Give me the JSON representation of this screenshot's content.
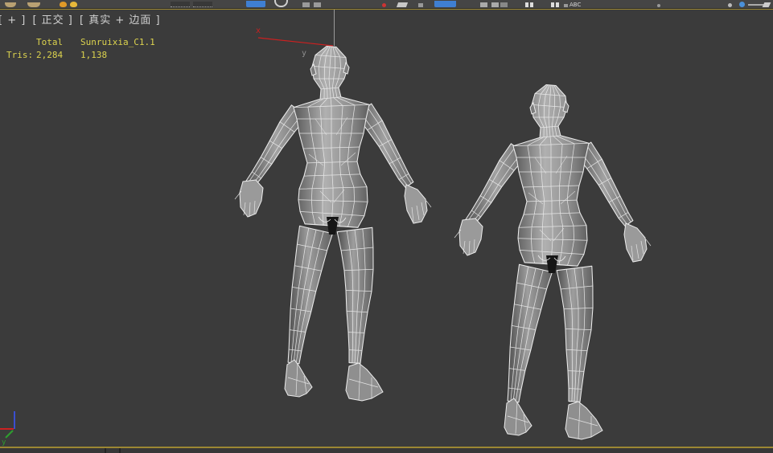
{
  "toolbar": {
    "abc_label": "ABC"
  },
  "viewport_label": {
    "maximize": "[ + ]",
    "view_type": "[ 正交 ]",
    "shading_mode": "[ 真实 + 边面 ]"
  },
  "statistics": {
    "col_total": "Total",
    "col_object": "Sunruixia_C1.1",
    "row_tris": "Tris:",
    "tris_total": "2,284",
    "tris_object": "1,138"
  },
  "axis_labels": {
    "gizmo_x": "x",
    "gizmo_y": "y",
    "world_y": "y"
  },
  "colors": {
    "viewport_bg": "#3b3b3b",
    "active_viewport_border": "#9c8733",
    "statistics_text": "#dcd34e",
    "viewport_label_text": "#cfcfcf",
    "wireframe": "#ececec",
    "gizmo_x_axis_red": "#cc2020",
    "gizmo_line_gray": "#9a9a9a",
    "world_axis_z_blue": "#3a4fd0",
    "world_axis_x_red": "#cc2222",
    "world_axis_y_green": "#2e9e2e",
    "toolbar_bg": "#454545",
    "toolbar_accent_blue": "#3f7fd2"
  }
}
